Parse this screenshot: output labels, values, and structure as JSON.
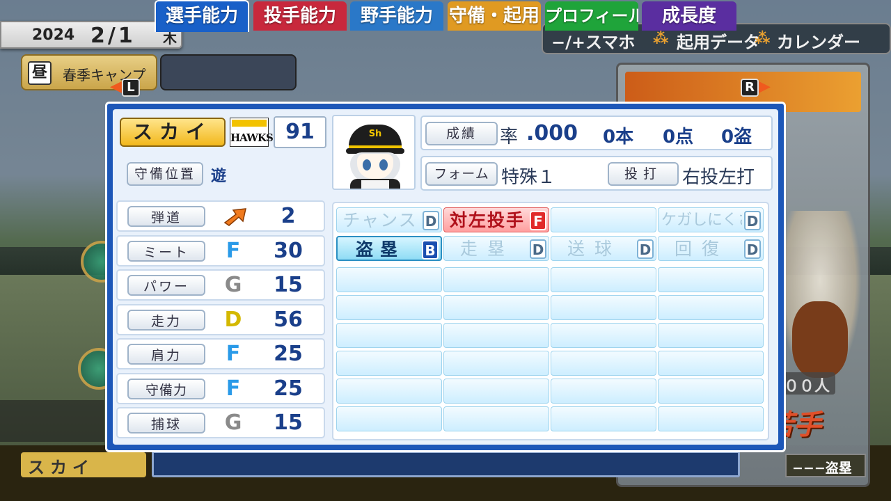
{
  "header": {
    "year": "2024",
    "month_day": "2/1",
    "day_of_week": "木",
    "phase_icon": "昼",
    "phase_text": "春季キャンプ",
    "menu": [
      {
        "label": "−/+スマホ",
        "icon": ""
      },
      {
        "label": "起用データ",
        "icon": "cluster-icon"
      },
      {
        "label": "カレンダー",
        "icon": "cluster-icon"
      }
    ]
  },
  "tabs": {
    "left_key": "L",
    "right_key": "R",
    "items": [
      {
        "label": "選手能力",
        "color": "#1960c8",
        "active": true
      },
      {
        "label": "投手能力",
        "color": "#c8283c"
      },
      {
        "label": "野手能力",
        "color": "#2a78c8"
      },
      {
        "label": "守備・起用",
        "color": "#e09a22"
      },
      {
        "label": "プロフィール",
        "color": "#1fa43a"
      },
      {
        "label": "成長度",
        "color": "#5a2ea0"
      }
    ]
  },
  "player": {
    "name": "スカイ",
    "team_logo_text": "HAWKS",
    "number": "91",
    "position_label": "守備位置",
    "position": "遊"
  },
  "stats": {
    "button": "成績",
    "rate_label": "率",
    "rate": ".000",
    "hr": "0本",
    "rbi": "0点",
    "sb": "0盗"
  },
  "form": {
    "button": "フォーム",
    "value": "特殊１",
    "throw_bat_button": "投打",
    "throw_bat": "右投左打"
  },
  "abilities": [
    {
      "label": "弾道",
      "rank": "",
      "value": "2",
      "rank_color": "#f07a1e"
    },
    {
      "label": "ミート",
      "rank": "F",
      "value": "30",
      "rank_color": "#2a9ae8"
    },
    {
      "label": "パワー",
      "rank": "G",
      "value": "15",
      "rank_color": "#8a8a8a"
    },
    {
      "label": "走力",
      "rank": "D",
      "value": "56",
      "rank_color": "#d4b800"
    },
    {
      "label": "肩力",
      "rank": "F",
      "value": "25",
      "rank_color": "#2a9ae8"
    },
    {
      "label": "守備力",
      "rank": "F",
      "value": "25",
      "rank_color": "#2a9ae8"
    },
    {
      "label": "捕球",
      "rank": "G",
      "value": "15",
      "rank_color": "#8a8a8a"
    }
  ],
  "skills": [
    [
      {
        "name": "チャンス",
        "grade": "D",
        "style": "grey"
      },
      {
        "name": "対左投手",
        "grade": "F",
        "style": "red"
      },
      {
        "name": "",
        "grade": "",
        "style": "empty"
      },
      {
        "name": "ケガしにくさ",
        "grade": "D",
        "style": "grey"
      }
    ],
    [
      {
        "name": "盗塁",
        "grade": "B",
        "style": "blue"
      },
      {
        "name": "走塁",
        "grade": "D",
        "style": "grey"
      },
      {
        "name": "送球",
        "grade": "D",
        "style": "grey"
      },
      {
        "name": "回復",
        "grade": "D",
        "style": "grey"
      }
    ]
  ],
  "background": {
    "count_text": "００人",
    "young_text": "若手",
    "steal_text": "−−−盗塁",
    "bottom_name": "スカイ"
  }
}
